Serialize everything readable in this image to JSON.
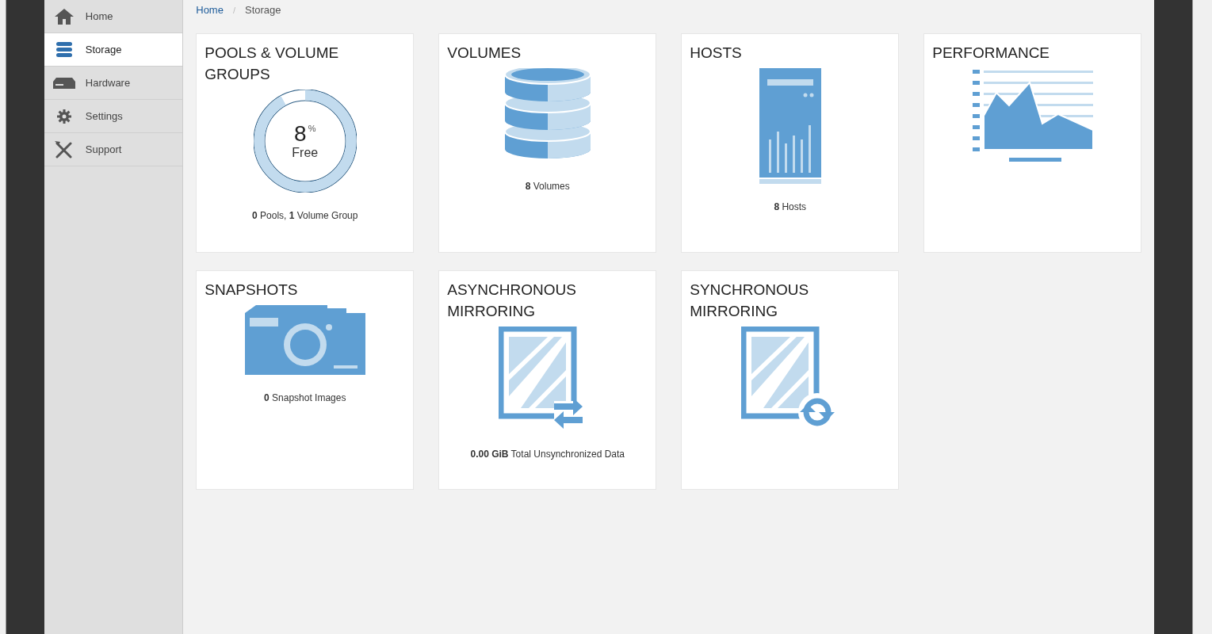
{
  "sidebar": {
    "items": [
      {
        "label": "Home",
        "kind": "home",
        "selected": false
      },
      {
        "label": "Storage",
        "kind": "storage",
        "selected": true
      },
      {
        "label": "Hardware",
        "kind": "hardware",
        "selected": false
      },
      {
        "label": "Settings",
        "kind": "settings",
        "selected": false
      },
      {
        "label": "Support",
        "kind": "support",
        "selected": false
      }
    ]
  },
  "breadcrumb": [
    {
      "label": "Home",
      "kind": "link"
    },
    {
      "label": "/",
      "kind": "separator"
    },
    {
      "label": "Storage",
      "kind": "current"
    }
  ],
  "cards": [
    {
      "title": "POOLS & VOLUME GROUPS",
      "kind": "pools",
      "gauge": {
        "value": "8",
        "unit": "%",
        "label": "Free",
        "level": 0.92
      },
      "summary": "**0** Pools, **1** Volume Group"
    },
    {
      "title": "VOLUMES",
      "kind": "volumes",
      "summary": "**8** Volumes"
    },
    {
      "title": "HOSTS",
      "kind": "hosts",
      "summary": "**8** Hosts"
    },
    {
      "title": "PERFORMANCE",
      "kind": "performance"
    },
    {
      "title": "SNAPSHOTS",
      "kind": "snapshots",
      "summary": "**0** Snapshot Images"
    },
    {
      "title": "ASYNCHRONOUS MIRRORING",
      "kind": "async",
      "summary": "**0.00 GiB** Total Unsynchronized Data"
    },
    {
      "title": "SYNCHRONOUS MIRRORING",
      "kind": "sync"
    }
  ]
}
